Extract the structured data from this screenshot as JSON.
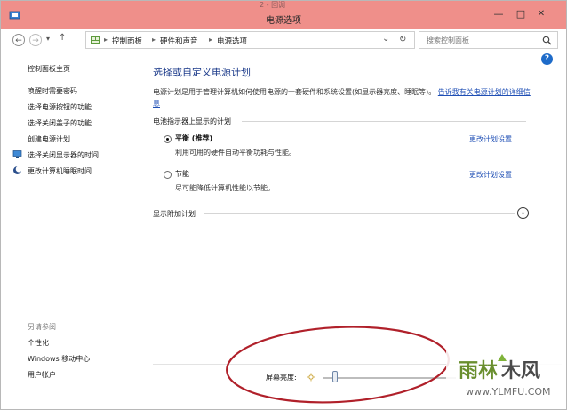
{
  "window": {
    "title": "电源选项",
    "top_overlay_text": "2 - 回调",
    "controls": {
      "minimize": "—",
      "maximize": "□",
      "close": "✕"
    }
  },
  "address_bar": {
    "back": "←",
    "forward": "→",
    "dropdown": "▾",
    "up": "↑",
    "breadcrumbs": [
      "控制面板",
      "硬件和声音",
      "电源选项"
    ],
    "separator": "▸",
    "dropdown_arrow": "⌄",
    "refresh": "↻",
    "search_placeholder": "搜索控制面板"
  },
  "sidebar": {
    "home": "控制面板主页",
    "items": [
      "唤醒时需要密码",
      "选择电源按钮的功能",
      "选择关闭盖子的功能",
      "创建电源计划",
      "选择关闭显示器的时间",
      "更改计算机睡眠时间"
    ],
    "see_also_title": "另请参阅",
    "see_also": [
      "个性化",
      "Windows 移动中心",
      "用户帐户"
    ]
  },
  "main": {
    "title": "选择或自定义电源计划",
    "description": "电源计划是用于管理计算机如何使用电源的一套硬件和系统设置(如显示器亮度、睡眠等)。",
    "description_link": "告诉我有关电源计划的详细信息",
    "group_label": "电池指示器上显示的计划",
    "plans": [
      {
        "name": "平衡 (推荐)",
        "desc": "利用可用的硬件自动平衡功耗与性能。",
        "link": "更改计划设置",
        "selected": true
      },
      {
        "name": "节能",
        "desc": "尽可能降低计算机性能以节能。",
        "link": "更改计划设置",
        "selected": false
      }
    ],
    "additional_label": "显示附加计划",
    "expand_icon": "⌄"
  },
  "bottom": {
    "brightness_label": "屏幕亮度:",
    "brightness_level": 0.07
  },
  "help_icon": "?",
  "colors": {
    "titlebar": "#ef8f8a",
    "link": "#1f4fb5",
    "heading": "#1b3a8a",
    "annotation": "#b0202a"
  }
}
